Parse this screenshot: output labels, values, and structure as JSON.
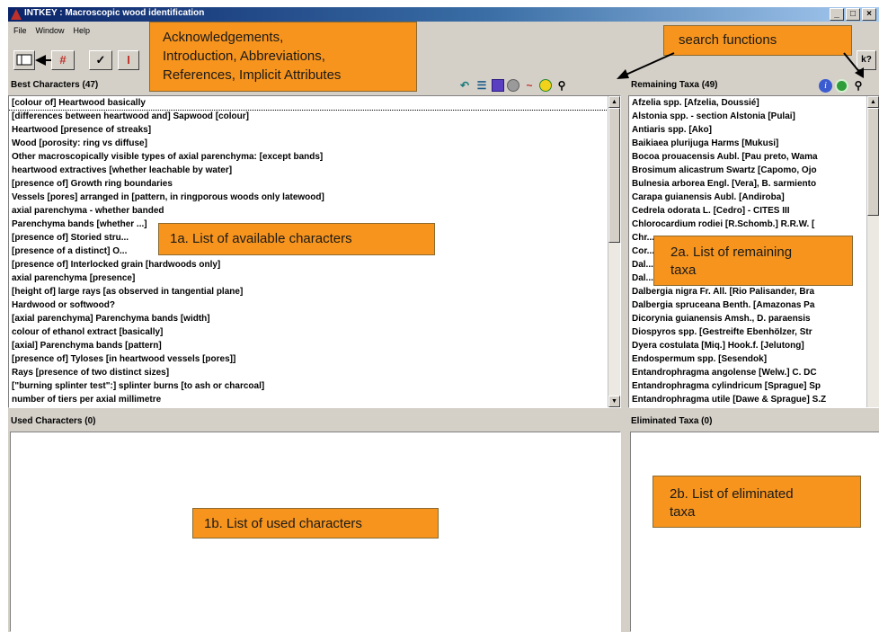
{
  "window": {
    "title": "INTKEY : Macroscopic wood identification",
    "minimize_glyph": "_",
    "maximize_glyph": "□",
    "close_glyph": "×"
  },
  "menu": [
    "File",
    "Window",
    "Help"
  ],
  "toolbar": {
    "hash_glyph": "#",
    "check_glyph": "✓",
    "info_glyph": "I",
    "help_glyph": "k?"
  },
  "best_characters": {
    "header": "Best Characters (47)",
    "items": [
      "[colour of] Heartwood basically",
      "[differences between heartwood and] Sapwood [colour]",
      "Heartwood [presence of streaks]",
      "Wood [porosity: ring vs diffuse]",
      "Other macroscopically visible types of axial parenchyma: [except bands]",
      "heartwood extractives [whether leachable by water]",
      "[presence of] Growth ring boundaries",
      "Vessels [pores] arranged in [pattern, in ringporous woods only latewood]",
      "axial parenchyma - whether banded",
      "Parenchyma bands [whether ...]",
      "[presence of] Storied stru...",
      "[presence of a distinct] O...",
      "[presence of] Interlocked grain [hardwoods only]",
      "axial parenchyma [presence]",
      "[height of] large rays [as observed in tangential plane]",
      "Hardwood or softwood?",
      "[axial parenchyma] Parenchyma bands [width]",
      "colour of ethanol extract [basically]",
      "[axial] Parenchyma bands [pattern]",
      "[presence of] Tyloses [in heartwood vessels [pores]]",
      "Rays [presence of two distinct sizes]",
      "[\"burning splinter test\":] splinter burns [to ash or charcoal]",
      "number of tiers per axial millimetre"
    ]
  },
  "remaining_taxa": {
    "header": "Remaining Taxa (49)",
    "items": [
      "Afzelia spp. [Afzelia, Doussié]",
      "Alstonia spp. - section Alstonia [Pulai]",
      "Antiaris spp. [Ako]",
      "Baikiaea plurijuga Harms [Mukusi]",
      "Bocoa prouacensis Aubl. [Pau preto, Wama",
      "Brosimum alicastrum Swartz [Capomo, Ojo",
      "Bulnesia arborea Engl. [Vera], B. sarmiento",
      "Carapa guianensis Aubl. [Andiroba]",
      "Cedrela odorata L. [Cedro] - CITES III",
      "Chlorocardium rodiei [R.Schomb.] R.R.W. [",
      "Chr...",
      "Cor...",
      "Dal...",
      "Dal...",
      "Dalbergia nigra Fr. All. [Rio Palisander, Bra",
      "Dalbergia spruceana Benth. [Amazonas Pa",
      "Dicorynia guianensis Amsh., D. paraensis",
      "Diospyros spp. [Gestreifte Ebenhölzer, Str",
      "Dyera costulata [Miq.] Hook.f. [Jelutong]",
      "Endospermum spp. [Sesendok]",
      "Entandrophragma angolense [Welw.] C. DC",
      "Entandrophragma cylindricum [Sprague] Sp",
      "Entandrophragma utile [Dawe & Sprague] S.Z"
    ]
  },
  "used_characters": {
    "header": "Used Characters (0)"
  },
  "eliminated_taxa": {
    "header": "Eliminated Taxa (0)"
  },
  "annotations": {
    "top_callout": [
      "Acknowledgements,",
      "Introduction, Abbreviations,",
      "References, Implicit Attributes"
    ],
    "search_functions": "search functions",
    "list_available": "1a. List of available characters",
    "list_remaining": [
      "2a. List of remaining",
      "taxa"
    ],
    "list_used": "1b. List of used characters",
    "list_eliminated": [
      "2b. List of eliminated",
      "taxa"
    ]
  },
  "colors": {
    "callout": "#f7941d",
    "chrome": "#d4d0c8",
    "title_start": "#0a246a",
    "title_end": "#a6caf0"
  },
  "icons": [
    "app-triangle-icon",
    "panel-icon",
    "hash-icon",
    "check-icon",
    "info-icon",
    "help-pointer-icon",
    "undo-arrow-icon",
    "lines-icon",
    "blue-square-icon",
    "gray-circle-icon",
    "tilde-icon",
    "yellow-circle-icon",
    "binoculars-icon",
    "info-circle-icon",
    "green-circle-icon"
  ]
}
